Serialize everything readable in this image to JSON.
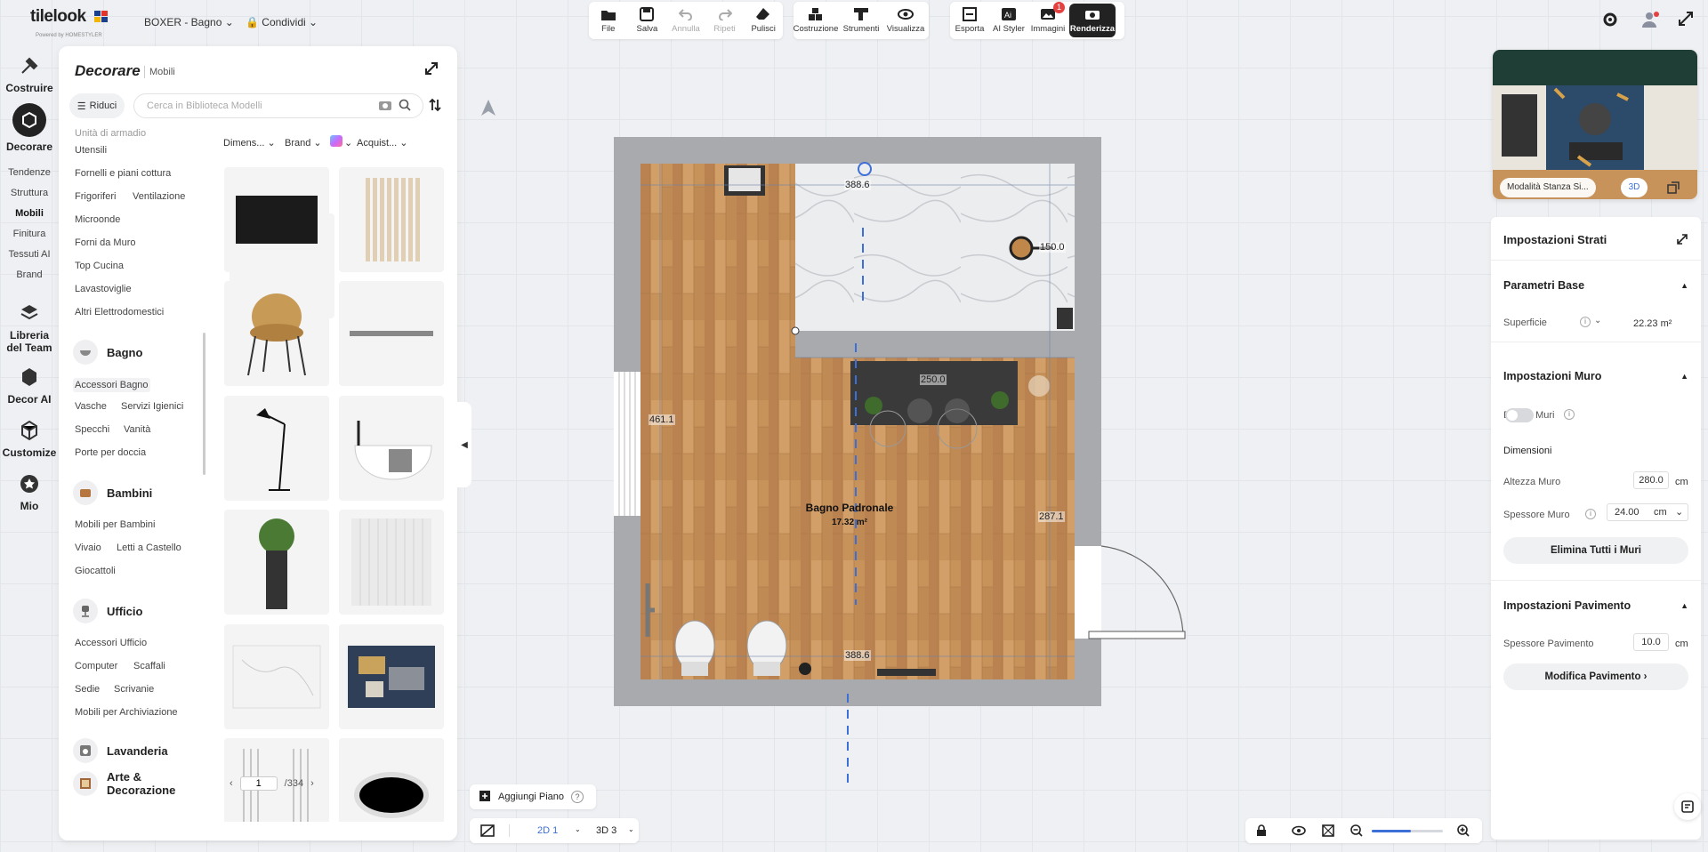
{
  "header": {
    "logo": "tilelook",
    "logo_sub": "Powered by HOMESTYLER",
    "project": "BOXER - Bagno",
    "share": "Condividi"
  },
  "toolbar": {
    "file": "File",
    "save": "Salva",
    "undo": "Annulla",
    "redo": "Ripeti",
    "clear": "Pulisci",
    "build": "Costruzione",
    "tools": "Strumenti",
    "view": "Visualizza",
    "export": "Esporta",
    "ai_styler": "AI Styler",
    "images": "Immagini",
    "images_badge": "1",
    "render": "Renderizza"
  },
  "rail": {
    "build": "Costruire",
    "decor": "Decorare",
    "trends": "Tendenze",
    "structure": "Struttura",
    "furniture": "Mobili",
    "finish": "Finitura",
    "ai_fabrics": "Tessuti AI",
    "brand": "Brand",
    "team_line1": "Libreria",
    "team_line2": "del Team",
    "decor_ai": "Decor AI",
    "customize": "Customize",
    "mine": "Mio"
  },
  "panel": {
    "title": "Decorare",
    "crumb": "Mobili",
    "riduci": "Riduci",
    "search_placeholder": "Cerca in Biblioteca Modelli",
    "categories": {
      "cut": "Unità di armadio",
      "utensili": "Utensili",
      "fornelli": "Fornelli e piani cottura",
      "frigoriferi": "Frigoriferi",
      "ventilazione": "Ventilazione",
      "microonde": "Microonde",
      "forni": "Forni da Muro",
      "top": "Top Cucina",
      "lavastoviglie": "Lavastoviglie",
      "altri": "Altri Elettrodomestici",
      "bagno": "Bagno",
      "accessori_bagno": "Accessori Bagno",
      "vasche": "Vasche",
      "servizi": "Servizi Igienici",
      "specchi": "Specchi",
      "vanita": "Vanità",
      "porte_doccia": "Porte per doccia",
      "bambini": "Bambini",
      "mobili_bambini": "Mobili per Bambini",
      "vivaio": "Vivaio",
      "letti": "Letti a Castello",
      "giocattoli": "Giocattoli",
      "ufficio": "Ufficio",
      "accessori_ufficio": "Accessori Ufficio",
      "computer": "Computer",
      "scaffali": "Scaffali",
      "sedie": "Sedie",
      "scrivanie": "Scrivanie",
      "archiviazione": "Mobili per Archiviazione",
      "lavanderia": "Lavanderia",
      "arte1": "Arte &",
      "arte2": "Decorazione"
    },
    "filters": {
      "dimensions": "Dimens...",
      "brand": "Brand",
      "purchase": "Acquist..."
    },
    "pager": {
      "page": "1",
      "total": "/334"
    }
  },
  "plan": {
    "room_name": "Bagno Padronale",
    "room_area": "17.32 m²",
    "dim_top": "388.6",
    "dim_bottom": "388.6",
    "dim_left": "461.1",
    "dim_right": "287.1",
    "dim_vanity": "250.0",
    "dim_shower": "150.0"
  },
  "right": {
    "preview_mode": "Modalità Stanza Si...",
    "preview_3d": "3D",
    "title": "Impostazioni Strati",
    "base": "Parametri Base",
    "surface_label": "Superficie",
    "surface_value": "22.23 m²",
    "wall": "Impostazioni Muro",
    "lock_walls": "Blocca Muri",
    "dimensions": "Dimensioni",
    "wall_height_label": "Altezza Muro",
    "wall_height": "280.0",
    "unit": "cm",
    "wall_thickness_label": "Spessore Muro",
    "wall_thickness": "24.00",
    "delete_walls": "Elimina Tutti i Muri",
    "floor": "Impostazioni Pavimento",
    "floor_thickness_label": "Spessore Pavimento",
    "floor_thickness": "10.0",
    "edit_floor": "Modifica Pavimento"
  },
  "bottom": {
    "add_floor": "Aggiungi Piano",
    "help": "?",
    "view2d": "2D 1",
    "view3d": "3D 3"
  },
  "colors": {
    "wood": "#c8935b",
    "marble": "#e9ebee",
    "wall": "#a9aaad",
    "accent": "#3d6fd8"
  }
}
